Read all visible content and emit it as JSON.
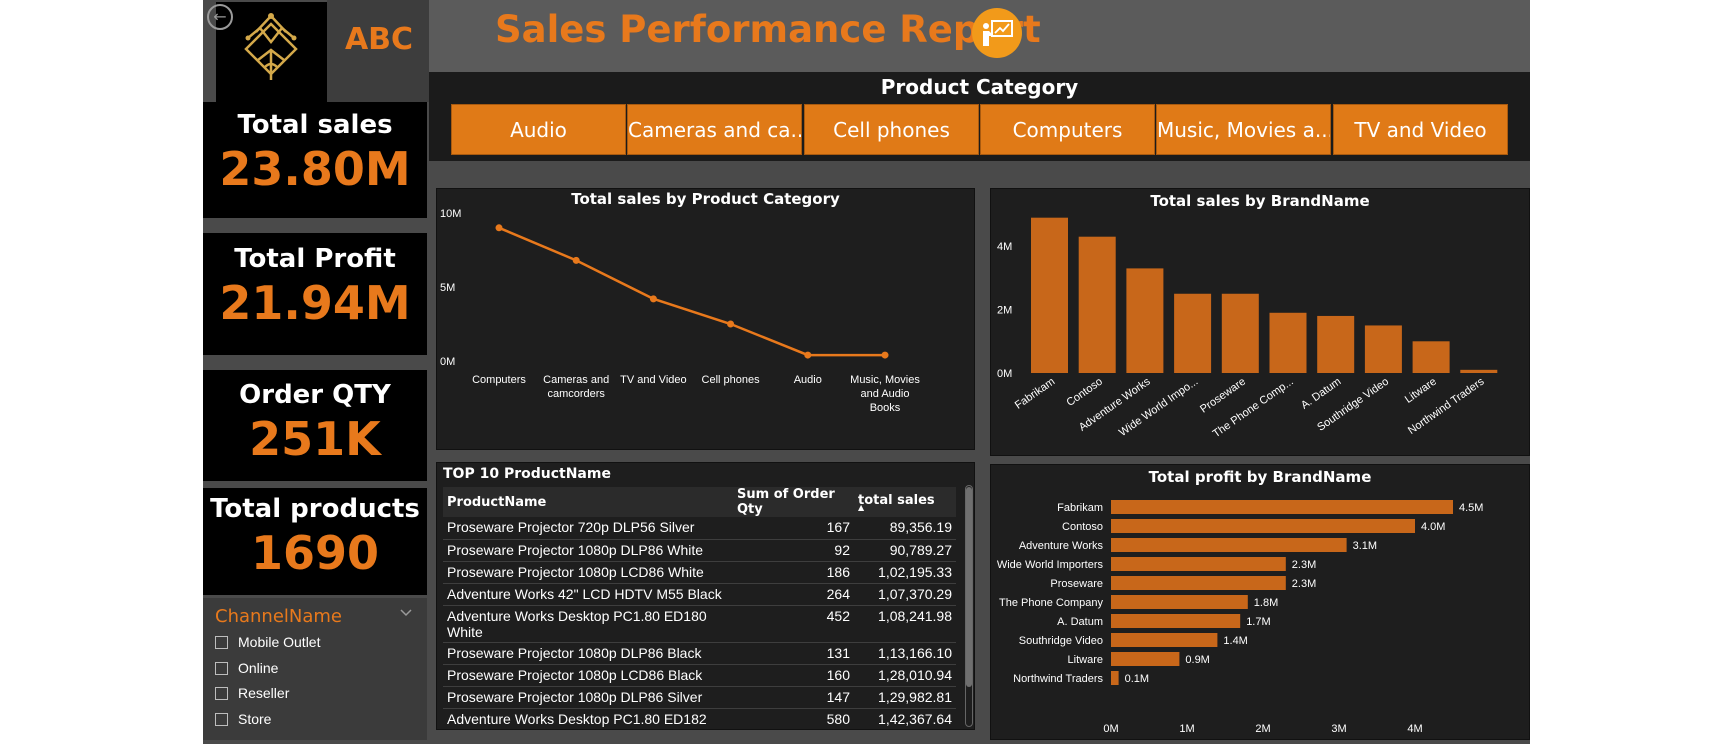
{
  "header": {
    "title": "Sales Performance Report",
    "brand": "ABC"
  },
  "kpis": {
    "total_sales": {
      "label": "Total sales",
      "value": "23.80M"
    },
    "total_profit": {
      "label": "Total Profit",
      "value": "21.94M"
    },
    "order_qty": {
      "label": "Order QTY",
      "value": "251K"
    },
    "total_products": {
      "label": "Total products",
      "value": "1690"
    }
  },
  "channel_slicer": {
    "title": "ChannelName",
    "items": [
      "Mobile Outlet",
      "Online",
      "Reseller",
      "Store"
    ]
  },
  "category_slicer": {
    "title": "Product Category",
    "buttons": [
      "Audio",
      "Cameras and ca...",
      "Cell phones",
      "Computers",
      "Music, Movies a...",
      "TV and Video"
    ]
  },
  "colors": {
    "accent": "#e8791c",
    "bar": "#c8671a",
    "background": "#4a4a4a",
    "panel": "#1e1e1e"
  },
  "chart_data": [
    {
      "type": "line",
      "title": "Total sales by Product Category",
      "categories": [
        "Computers",
        "Cameras and camcorders",
        "TV and Video",
        "Cell phones",
        "Audio",
        "Music, Movies and Audio Books"
      ],
      "values": [
        9.0,
        6.8,
        4.2,
        2.5,
        0.4,
        0.4
      ],
      "unit": "M",
      "yticks": [
        "10M",
        "5M",
        "0M"
      ],
      "ylim": [
        0,
        10
      ]
    },
    {
      "type": "bar",
      "title": "Total sales by BrandName",
      "categories": [
        "Fabrikam",
        "Contoso",
        "Adventure Works",
        "Wide World Impo...",
        "Proseware",
        "The Phone Comp...",
        "A. Datum",
        "Southridge Video",
        "Litware",
        "Northwind Traders"
      ],
      "values": [
        4.9,
        4.3,
        3.3,
        2.5,
        2.5,
        1.9,
        1.8,
        1.5,
        1.0,
        0.1
      ],
      "unit": "M",
      "yticks": [
        "4M",
        "2M",
        "0M"
      ],
      "ylim": [
        0,
        5.3
      ]
    },
    {
      "type": "bar",
      "orientation": "horizontal",
      "title": "Total profit by BrandName",
      "categories": [
        "Fabrikam",
        "Contoso",
        "Adventure Works",
        "Wide World Importers",
        "Proseware",
        "The Phone Company",
        "A. Datum",
        "Southridge Video",
        "Litware",
        "Northwind Traders"
      ],
      "values": [
        4.5,
        4.0,
        3.1,
        2.3,
        2.3,
        1.8,
        1.7,
        1.4,
        0.9,
        0.1
      ],
      "labels": [
        "4.5M",
        "4.0M",
        "3.1M",
        "2.3M",
        "2.3M",
        "1.8M",
        "1.7M",
        "1.4M",
        "0.9M",
        "0.1M"
      ],
      "xticks": [
        "0M",
        "1M",
        "2M",
        "3M",
        "4M"
      ],
      "xlim": [
        0,
        4.5
      ]
    }
  ],
  "table": {
    "title": "TOP 10 ProductName",
    "columns": [
      "ProductName",
      "Sum of Order Qty",
      "total sales"
    ],
    "rows": [
      [
        "Proseware Projector 720p DLP56 Silver",
        "167",
        "89,356.19"
      ],
      [
        "Proseware Projector 1080p DLP86 White",
        "92",
        "90,789.27"
      ],
      [
        "Proseware Projector 1080p LCD86 White",
        "186",
        "1,02,195.33"
      ],
      [
        "Adventure Works 42\" LCD HDTV M55 Black",
        "264",
        "1,07,370.29"
      ],
      [
        "Adventure Works Desktop PC1.80 ED180 White",
        "452",
        "1,08,241.98"
      ],
      [
        "Proseware Projector 1080p DLP86 Black",
        "131",
        "1,13,166.10"
      ],
      [
        "Proseware Projector 1080p LCD86 Black",
        "160",
        "1,28,010.94"
      ],
      [
        "Proseware Projector 1080p DLP86 Silver",
        "147",
        "1,29,982.81"
      ],
      [
        "Adventure Works Desktop PC1.80 ED182",
        "580",
        "1,42,367.64"
      ]
    ]
  }
}
